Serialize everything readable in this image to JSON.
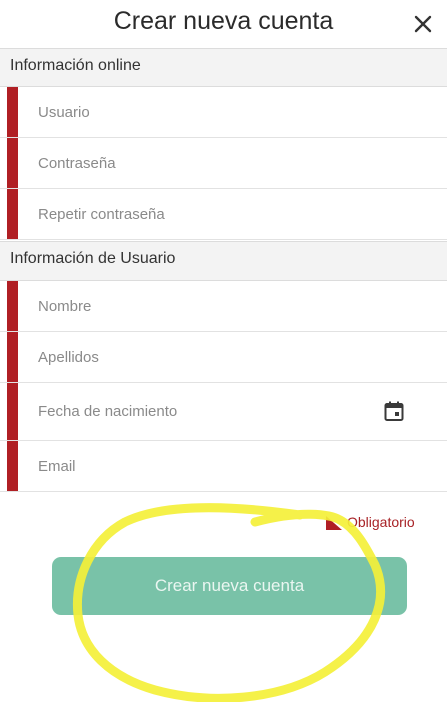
{
  "header": {
    "title": "Crear nueva cuenta",
    "close_icon": "close-icon"
  },
  "sections": [
    {
      "title": "Información online",
      "fields": [
        {
          "placeholder": "Usuario",
          "value": "",
          "required": true
        },
        {
          "placeholder": "Contraseña",
          "value": "",
          "required": true
        },
        {
          "placeholder": "Repetir contraseña",
          "value": "",
          "required": true
        }
      ]
    },
    {
      "title": "Información de Usuario",
      "fields": [
        {
          "placeholder": "Nombre",
          "value": "",
          "required": true
        },
        {
          "placeholder": "Apellidos",
          "value": "",
          "required": true
        },
        {
          "placeholder": "Fecha de nacimiento",
          "value": "",
          "required": true,
          "icon": "calendar-icon"
        },
        {
          "placeholder": "Email",
          "value": "",
          "required": true
        }
      ]
    }
  ],
  "legend": {
    "label": "Obligatorio",
    "icon": "required-flag-icon"
  },
  "submit": {
    "label": "Crear nueva cuenta"
  },
  "colors": {
    "required_accent": "#b01f24",
    "button_bg": "#79c2a8",
    "section_bg": "#f3f3f3",
    "annotation": "#f4f03a"
  }
}
